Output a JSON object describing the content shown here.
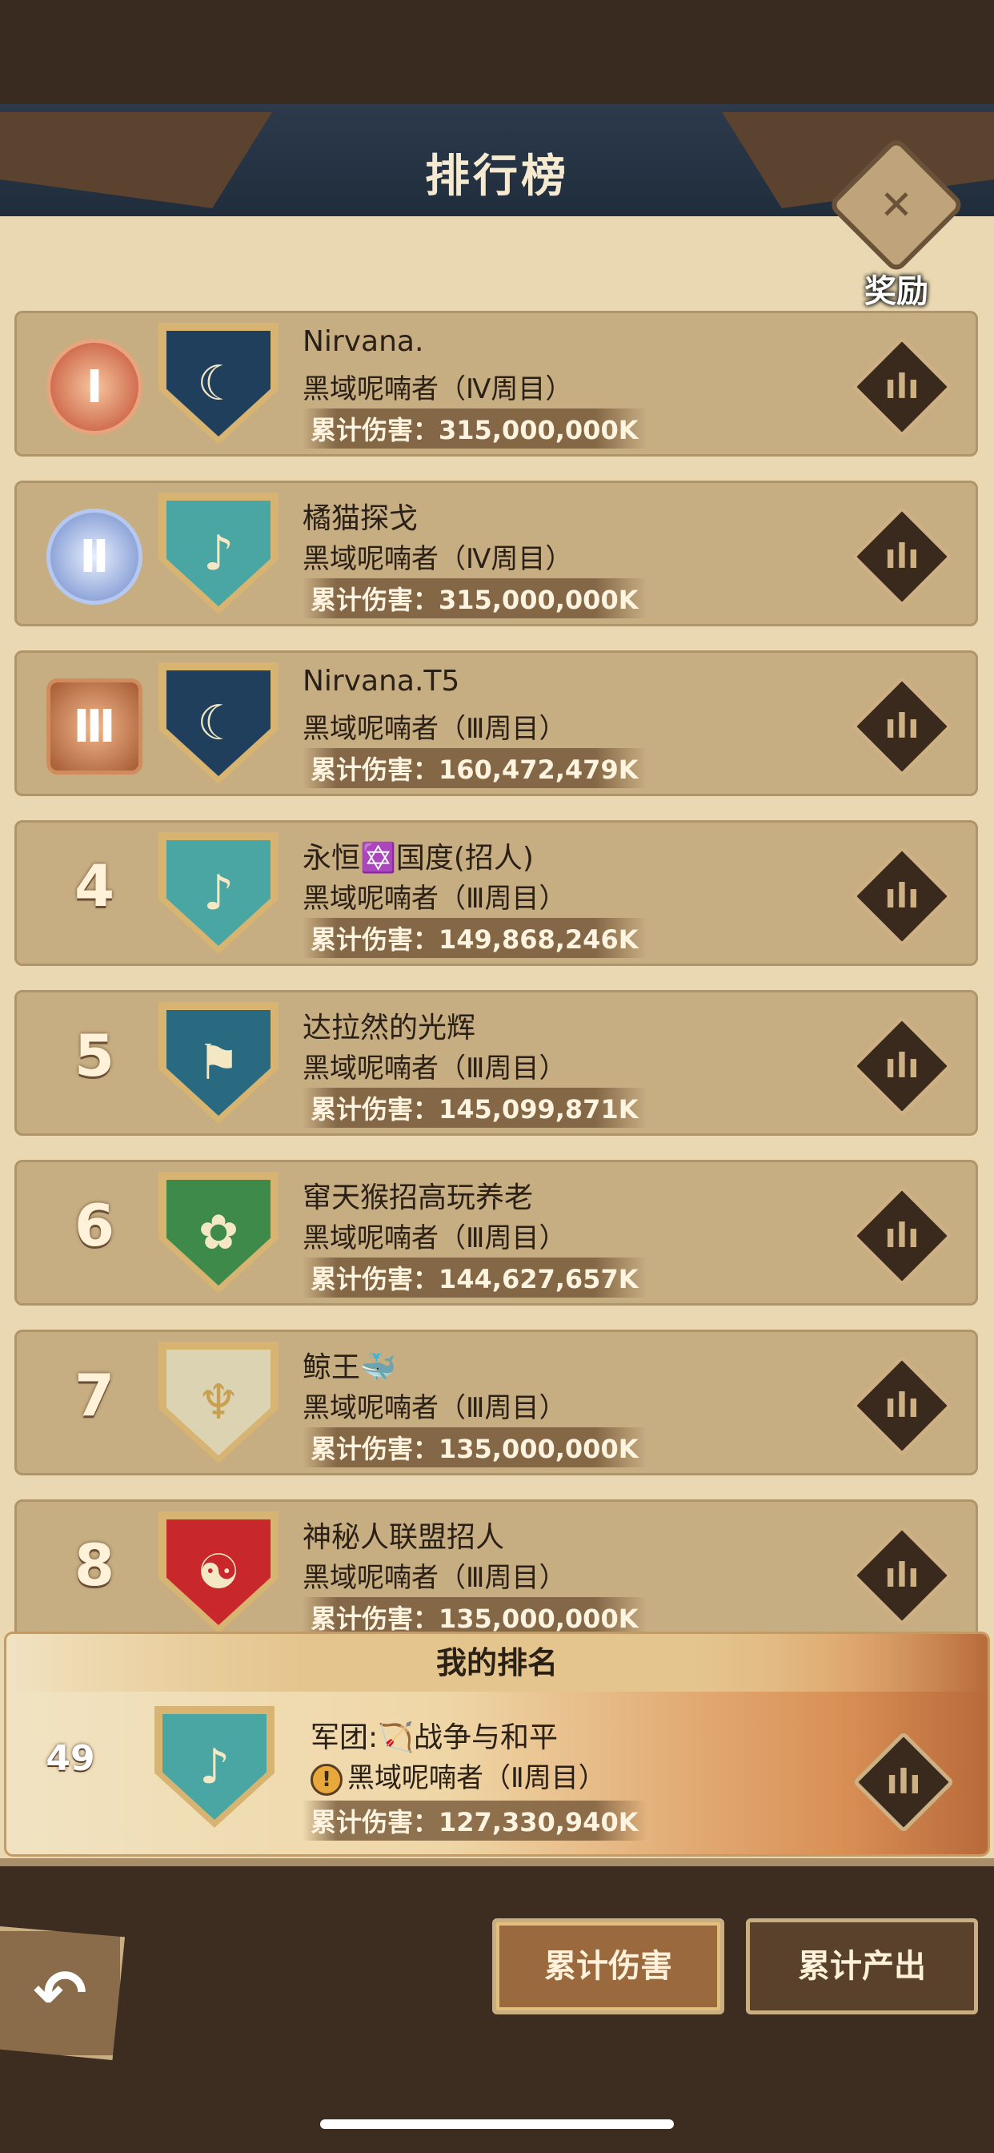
{
  "header": {
    "title": "排行榜",
    "reward_label": "奖励"
  },
  "entries": [
    {
      "rank": "",
      "medal": "gold",
      "shield": "dark",
      "name": "Nirvana.",
      "boss": "黑域呢喃者（Ⅳ周目）",
      "damage": "累计伤害：315,000,000K"
    },
    {
      "rank": "",
      "medal": "silver",
      "shield": "teal",
      "name": "橘猫探戈",
      "boss": "黑域呢喃者（Ⅳ周目）",
      "damage": "累计伤害：315,000,000K"
    },
    {
      "rank": "",
      "medal": "bronze",
      "shield": "dark",
      "name": "Nirvana.T5",
      "boss": "黑域呢喃者（Ⅲ周目）",
      "damage": "累计伤害：160,472,479K"
    },
    {
      "rank": "4",
      "medal": "",
      "shield": "teal",
      "name": "永恒✡️国度(招人)",
      "boss": "黑域呢喃者（Ⅲ周目）",
      "damage": "累计伤害：149,868,246K"
    },
    {
      "rank": "5",
      "medal": "",
      "shield": "wiz",
      "name": "达拉然的光辉",
      "boss": "黑域呢喃者（Ⅲ周目）",
      "damage": "累计伤害：145,099,871K"
    },
    {
      "rank": "6",
      "medal": "",
      "shield": "green",
      "name": "窜天猴招高玩养老",
      "boss": "黑域呢喃者（Ⅲ周目）",
      "damage": "累计伤害：144,627,657K"
    },
    {
      "rank": "7",
      "medal": "",
      "shield": "cream",
      "name": "鲸王🐳",
      "boss": "黑域呢喃者（Ⅲ周目）",
      "damage": "累计伤害：135,000,000K"
    },
    {
      "rank": "8",
      "medal": "",
      "shield": "red",
      "name": "神秘人联盟招人",
      "boss": "黑域呢喃者（Ⅲ周目）",
      "damage": "累计伤害：135,000,000K"
    }
  ],
  "medal_text": {
    "gold": "Ⅰ",
    "silver": "Ⅱ",
    "bronze": "Ⅲ"
  },
  "my_rank": {
    "title": "我的排名",
    "rank": "49",
    "name": "军团:🏹战争与和平",
    "boss": "黑域呢喃者（Ⅱ周目）",
    "damage": "累计伤害：127,330,940K"
  },
  "tabs": {
    "damage": "累计伤害",
    "output": "累计产出"
  },
  "icons": {
    "stats": "bar-chart-icon",
    "back": "back-arrow-icon",
    "reward": "reward-crest-icon"
  }
}
